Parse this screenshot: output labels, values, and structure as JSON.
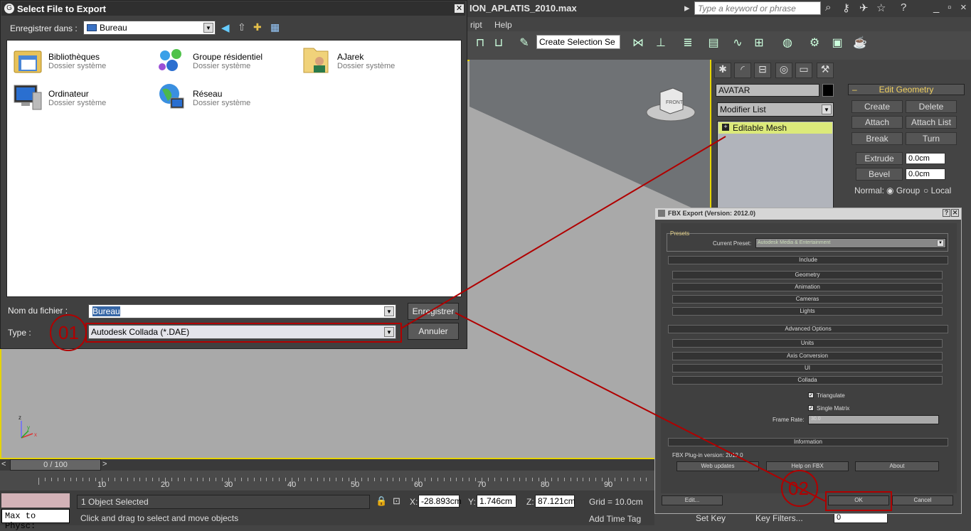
{
  "max": {
    "title": "ION_APLATIS_2010.max",
    "search_placeholder": "Type a keyword or phrase",
    "menu": [
      "ript",
      "Help"
    ],
    "selection_set": "Create Selection Se",
    "object_name": "AVATAR",
    "modifier_list": "Modifier List",
    "stack_item": "Editable Mesh",
    "rollout": {
      "title": "Edit Geometry",
      "buttons": [
        "Create",
        "Delete",
        "Attach",
        "Attach List",
        "Break",
        "Turn"
      ],
      "extrude_label": "Extrude",
      "extrude_value": "0.0cm",
      "bevel_label": "Bevel",
      "bevel_value": "0.0cm",
      "normal_label": "Normal:",
      "normal_options": [
        "Group",
        "Local"
      ]
    },
    "time_slider": "0 / 100",
    "ruler_ticks": [
      "10",
      "20",
      "30",
      "40",
      "50",
      "60",
      "70",
      "80",
      "90"
    ],
    "status": {
      "selected": "1 Object Selected",
      "prompt": "Click and drag to select and move objects",
      "listener": "Max to Physc:",
      "x_label": "X:",
      "x_value": "-28.893cm",
      "y_label": "Y:",
      "y_value": "1.746cm",
      "z_label": "Z:",
      "z_value": "87.121cm",
      "grid": "Grid = 10.0cm",
      "add_time_tag": "Add Time Tag",
      "set_key": "Set Key",
      "key_filters": "Key Filters...",
      "frame": "0"
    },
    "viewcube_label": "FRONT",
    "axes": {
      "x": "x",
      "y": "y",
      "z": "z"
    }
  },
  "file_dialog": {
    "title": "Select File to Export",
    "save_in_label": "Enregistrer dans :",
    "save_in_value": "Bureau",
    "items": [
      {
        "name": "Bibliothèques",
        "sub": "Dossier système"
      },
      {
        "name": "Groupe résidentiel",
        "sub": "Dossier système"
      },
      {
        "name": "AJarek",
        "sub": "Dossier système"
      },
      {
        "name": "Ordinateur",
        "sub": "Dossier système"
      },
      {
        "name": "Réseau",
        "sub": "Dossier système"
      }
    ],
    "filename_label": "Nom du fichier :",
    "filename_value": "Bureau",
    "type_label": "Type :",
    "type_value": "Autodesk Collada (*.DAE)",
    "save_button": "Enregistrer",
    "cancel_button": "Annuler"
  },
  "fbx_dialog": {
    "title": "FBX Export (Version: 2012.0)",
    "presets_label": "Presets",
    "current_preset_label": "Current Preset:",
    "current_preset_value": "Autodesk Media & Entertainment",
    "include_label": "Include",
    "include_items": [
      "Geometry",
      "Animation",
      "Cameras",
      "Lights"
    ],
    "advanced_label": "Advanced Options",
    "advanced_items": [
      "Units",
      "Axis Conversion",
      "UI"
    ],
    "collada_label": "Collada",
    "triangulate_label": "Triangulate",
    "single_matrix_label": "Single Matrix",
    "frame_rate_label": "Frame Rate:",
    "frame_rate_value": "30.0",
    "information_label": "Information",
    "plugin_version": "FBX Plug-in version: 2012.0",
    "web_updates": "Web updates",
    "help_on_fbx": "Help on FBX",
    "about": "About",
    "edit_button": "Edit...",
    "ok_button": "OK",
    "cancel_button": "Cancel"
  },
  "annotations": {
    "step1": "01",
    "step2": "02",
    "color": "#b00000"
  }
}
